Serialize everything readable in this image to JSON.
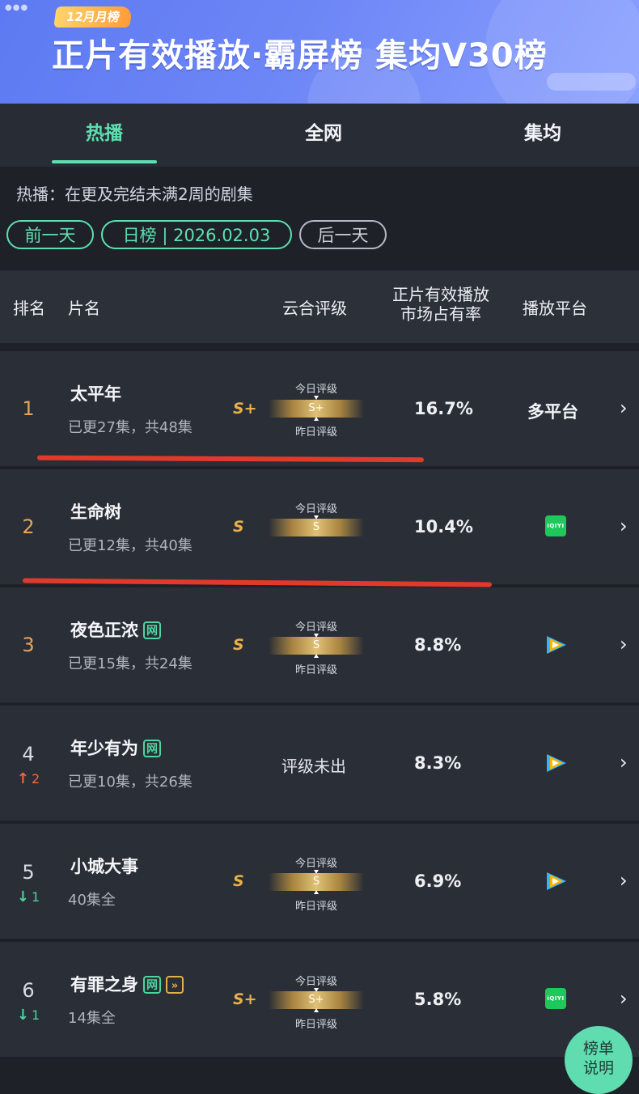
{
  "banner": {
    "badge": "12月月榜",
    "title": "正片有效播放·霸屏榜 集均V30榜"
  },
  "tabs": [
    {
      "label": "热播",
      "active": true
    },
    {
      "label": "全网",
      "active": false
    },
    {
      "label": "集均",
      "active": false
    }
  ],
  "description": "热播：在更及完结未满2周的剧集",
  "controls": {
    "prev_day": "前一天",
    "date_label": "日榜 | 2026.02.03",
    "next_day": "后一天"
  },
  "table_header": {
    "rank": "排名",
    "name": "片名",
    "grade": "云合评级",
    "share_line1": "正片有效播放",
    "share_line2": "市场占有率",
    "platform": "播放平台"
  },
  "grade_labels": {
    "today": "今日评级",
    "yesterday": "昨日评级"
  },
  "rows": [
    {
      "rank": "1",
      "title": "太平年",
      "episodes": "已更27集，共48集",
      "grade": "S+",
      "bar_grade": "S+",
      "share": "16.7%",
      "platform": "多平台",
      "platform_icon": "multi"
    },
    {
      "rank": "2",
      "title": "生命树",
      "episodes": "已更12集，共40集",
      "grade": "S",
      "bar_grade": "S",
      "share": "10.4%",
      "platform_icon": "iqiyi-icon",
      "iqiyi_label": "iQIYI"
    },
    {
      "rank": "3",
      "title": "夜色正浓",
      "tag": "网",
      "episodes": "已更15集，共24集",
      "grade": "S",
      "bar_grade": "S",
      "share": "8.8%",
      "platform_icon": "tencent-video-icon"
    },
    {
      "rank": "4",
      "change_dir": "up",
      "change_arrow": "↑",
      "change_num": "2",
      "title": "年少有为",
      "tag": "网",
      "episodes": "已更10集，共26集",
      "grade_text": "评级未出",
      "share": "8.3%",
      "platform_icon": "tencent-video-icon"
    },
    {
      "rank": "5",
      "change_dir": "down",
      "change_arrow": "↓",
      "change_num": "1",
      "title": "小城大事",
      "episodes": "40集全",
      "grade": "S",
      "bar_grade": "S",
      "share": "6.9%",
      "platform_icon": "tencent-video-icon"
    },
    {
      "rank": "6",
      "change_dir": "down",
      "change_arrow": "↓",
      "change_num": "1",
      "title": "有罪之身",
      "tag": "网",
      "tag2": "»",
      "episodes": "14集全",
      "grade": "S+",
      "bar_grade": "S+",
      "share": "5.8%",
      "platform_icon": "iqiyi-icon",
      "iqiyi_label": "iQIYI"
    }
  ],
  "chevron": "›",
  "float_button": {
    "line1": "榜单",
    "line2": "说明"
  },
  "colors": {
    "accent": "#5de0b0",
    "grade_gold": "#e9b04a",
    "annotation_red": "#e23a2a"
  }
}
